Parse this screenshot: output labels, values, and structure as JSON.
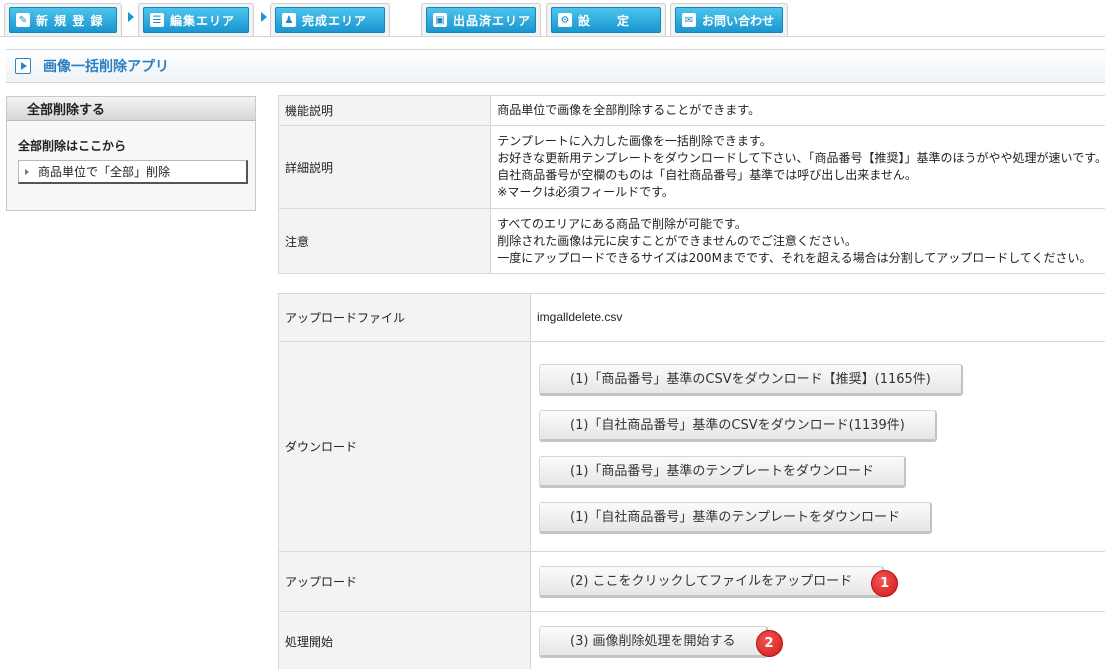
{
  "tabs": [
    {
      "label": "新 規 登 録",
      "icon": "pencil-icon",
      "glyph": "✎"
    },
    {
      "label": "編集エリア",
      "icon": "list-icon",
      "glyph": "☰"
    },
    {
      "label": "完成エリア",
      "icon": "people-icon",
      "glyph": "♟"
    },
    {
      "label": "出品済エリア",
      "icon": "box-icon",
      "glyph": "▣"
    },
    {
      "label": "設　　定",
      "icon": "gear-icon",
      "glyph": "⚙"
    },
    {
      "label": "お問い合わせ",
      "icon": "chat-icon",
      "glyph": "✉"
    }
  ],
  "page": {
    "title": "画像一括削除アプリ"
  },
  "sidebar": {
    "header": "全部削除する",
    "subheading": "全部削除はここから",
    "item": "商品単位で「全部」削除"
  },
  "info": {
    "rows": [
      {
        "label": "機能説明",
        "lines": [
          "商品単位で画像を全部削除することができます。"
        ]
      },
      {
        "label": "詳細説明",
        "lines": [
          "テンプレートに入力した画像を一括削除できます。",
          "お好きな更新用テンプレートをダウンロードして下さい、「商品番号【推奨】」基準のほうがやや処理が速いです。",
          "自社商品番号が空欄のものは「自社商品番号」基準では呼び出し出来ません。",
          "※マークは必須フィールドです。"
        ]
      },
      {
        "label": "注意",
        "lines": [
          "すべてのエリアにある商品で削除が可能です。",
          "削除された画像は元に戻すことができませんのでご注意ください。",
          "一度にアップロードできるサイズは200Mまでです、それを超える場合は分割してアップロードしてください。"
        ]
      }
    ]
  },
  "upload_form": {
    "file_label": "アップロードファイル",
    "file_name": "imgalldelete.csv",
    "download_label": "ダウンロード",
    "download_buttons": [
      "(1)「商品番号」基準のCSVをダウンロード【推奨】(1165件)",
      "(1)「自社商品番号」基準のCSVをダウンロード(1139件)",
      "(1)「商品番号」基準のテンプレートをダウンロード",
      "(1)「自社商品番号」基準のテンプレートをダウンロード"
    ],
    "upload_label": "アップロード",
    "upload_button": "(2) ここをクリックしてファイルをアップロード",
    "upload_badge": "1",
    "start_label": "処理開始",
    "start_button": "(3) 画像削除処理を開始する",
    "start_badge": "2"
  },
  "colors": {
    "tab_blue": "#1a96d0",
    "title_blue": "#2a7fc0",
    "badge_red": "#d21818"
  }
}
